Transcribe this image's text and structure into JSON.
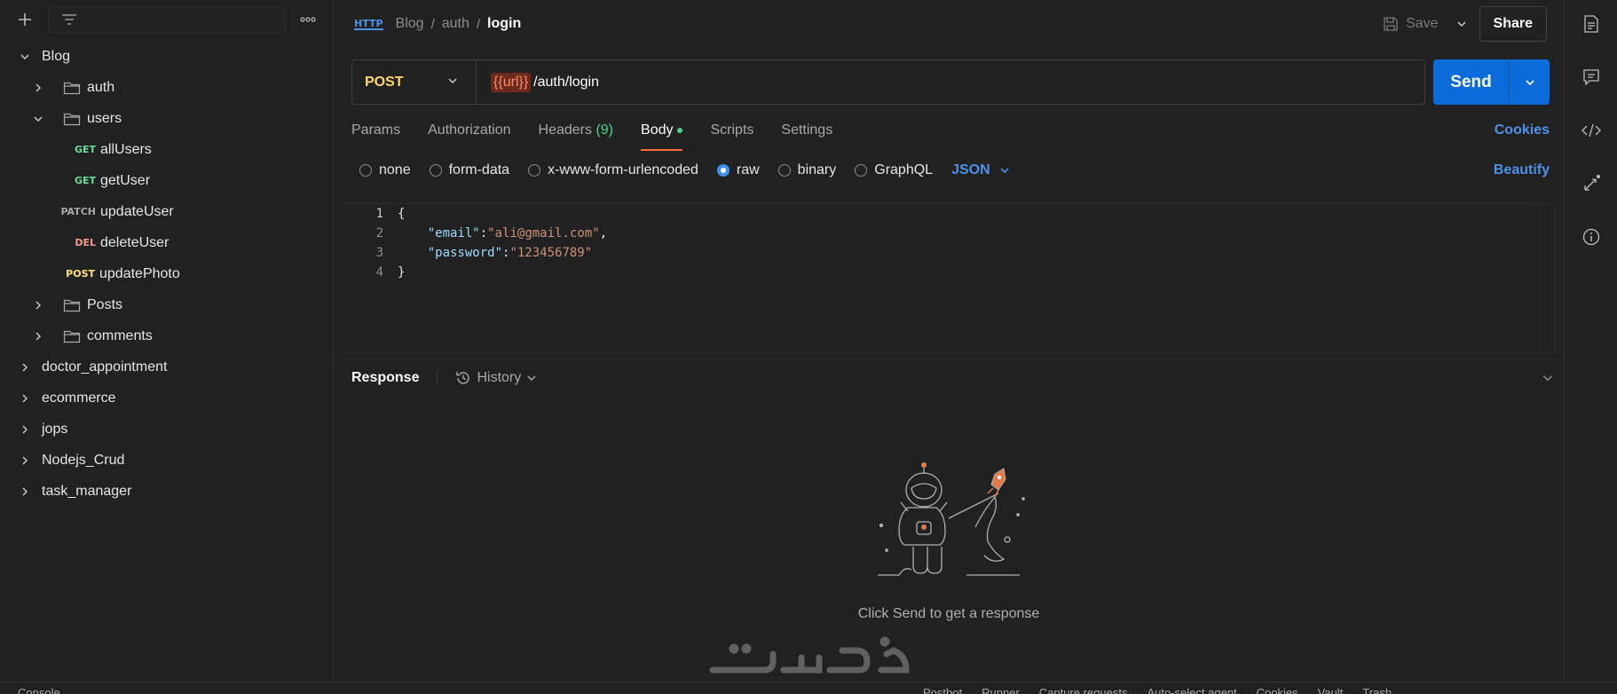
{
  "sidebar": {
    "tree": [
      {
        "label": "Blog",
        "type": "collection",
        "expanded": true
      },
      {
        "label": "auth",
        "type": "folder",
        "expanded": false
      },
      {
        "label": "users",
        "type": "folder",
        "expanded": true
      },
      {
        "method": "GET",
        "label": "allUsers",
        "type": "request"
      },
      {
        "method": "GET",
        "label": "getUser",
        "type": "request"
      },
      {
        "method": "PATCH",
        "label": "updateUser",
        "type": "request"
      },
      {
        "method": "DEL",
        "label": "deleteUser",
        "type": "request"
      },
      {
        "method": "POST",
        "label": "updatePhoto",
        "type": "request"
      },
      {
        "label": "Posts",
        "type": "folder",
        "expanded": false
      },
      {
        "label": "comments",
        "type": "folder",
        "expanded": false
      },
      {
        "label": "doctor_appointment",
        "type": "collection",
        "expanded": false
      },
      {
        "label": "ecommerce",
        "type": "collection",
        "expanded": false
      },
      {
        "label": "jops",
        "type": "collection",
        "expanded": false
      },
      {
        "label": "Nodejs_Crud",
        "type": "collection",
        "expanded": false
      },
      {
        "label": "task_manager",
        "type": "collection",
        "expanded": false
      }
    ]
  },
  "header": {
    "protocol_badge": "HTTP",
    "breadcrumb": [
      "Blog",
      "auth"
    ],
    "current": "login",
    "save_label": "Save",
    "share_label": "Share"
  },
  "request": {
    "method": "POST",
    "url_variable": "{{url}}",
    "url_path": "/auth/login",
    "send_label": "Send"
  },
  "tabs": {
    "params": "Params",
    "authorization": "Authorization",
    "headers": "Headers",
    "headers_count": "(9)",
    "body": "Body",
    "scripts": "Scripts",
    "settings": "Settings",
    "cookies": "Cookies"
  },
  "body_options": {
    "none": "none",
    "form_data": "form-data",
    "urlencoded": "x-www-form-urlencoded",
    "raw": "raw",
    "binary": "binary",
    "graphql": "GraphQL",
    "language": "JSON",
    "beautify": "Beautify",
    "selected": "raw"
  },
  "editor": {
    "line_numbers": [
      "1",
      "2",
      "3",
      "4"
    ],
    "open_brace": "{",
    "close_brace": "}",
    "email_key": "\"email\"",
    "email_value": "\"ali@gmail.com\"",
    "password_key": "\"password\"",
    "password_value": "\"123456789\""
  },
  "response": {
    "title": "Response",
    "history_label": "History",
    "empty_message": "Click Send to get a response"
  },
  "watermark": "خمسات",
  "status_bar": {
    "left": "Console",
    "right": [
      "Postbot",
      "Runner",
      "Capture requests",
      "Auto-select agent",
      "Cookies",
      "Vault",
      "Trash"
    ]
  },
  "colors": {
    "accent_orange": "#ff6c37",
    "send_blue": "#0b6bd8",
    "link_blue": "#4e92e8",
    "get_green": "#6bdd9a",
    "post_yellow": "#ffe47e",
    "del_red": "#f79a8e"
  }
}
